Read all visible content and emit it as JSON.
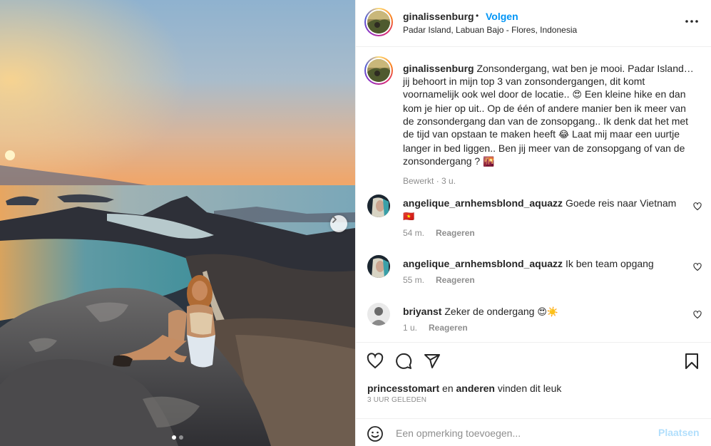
{
  "post": {
    "author": "ginalissenburg",
    "separator": "•",
    "follow_label": "Volgen",
    "location": "Padar Island, Labuan Bajo - Flores, Indonesia",
    "more_icon": "more-horizontal-icon"
  },
  "caption": {
    "username": "ginalissenburg",
    "text_1": "Zonsondergang, wat ben je mooi. Padar Island… jij behoort in mijn top 3 van zonsondergangen, dit komt voornamelijk ook wel door de locatie..",
    "emoji_1": "😍",
    "text_2": "Een kleine hike en dan kom je hier op uit.. Op de één of andere manier ben ik meer van de zonsondergang dan van de zonsopgang.. Ik denk dat het met de tijd van opstaan te maken heeft",
    "emoji_2": "😂",
    "text_3": "Laat mij maar een uurtje langer in bed liggen.. Ben jij meer van de zonsopgang of van de zonsondergang ?",
    "emoji_3": "🌇",
    "edited": "Bewerkt",
    "meta_sep": "·",
    "age": "3 u."
  },
  "comments": [
    {
      "username": "angelique_arnhemsblond_aquazz",
      "text": "Goede reis naar Vietnam",
      "emoji": "🇻🇳",
      "age": "54 m.",
      "reply": "Reageren"
    },
    {
      "username": "angelique_arnhemsblond_aquazz",
      "text": "Ik ben team opgang",
      "emoji": "",
      "age": "55 m.",
      "reply": "Reageren"
    },
    {
      "username": "briyanst",
      "text": "Zeker de ondergang",
      "emoji": "😍☀️",
      "age": "1 u.",
      "reply": "Reageren"
    }
  ],
  "actions": {
    "like_icon": "heart-icon",
    "comment_icon": "comment-icon",
    "share_icon": "paper-plane-icon",
    "save_icon": "bookmark-icon"
  },
  "likes": {
    "user": "princesstomart",
    "and": "en",
    "others": "anderen",
    "suffix": "vinden dit leuk"
  },
  "posted_time": "3 UUR GELEDEN",
  "add_comment": {
    "placeholder": "Een opmerking toevoegen...",
    "post_label": "Plaatsen",
    "emoji_icon": "smiley-icon"
  },
  "carousel": {
    "current_slide": 1,
    "total_slides": 2
  },
  "colors": {
    "accent": "#0095f6",
    "post_disabled": "#b2dffc",
    "muted": "#8e8e8e",
    "text": "#262626"
  }
}
